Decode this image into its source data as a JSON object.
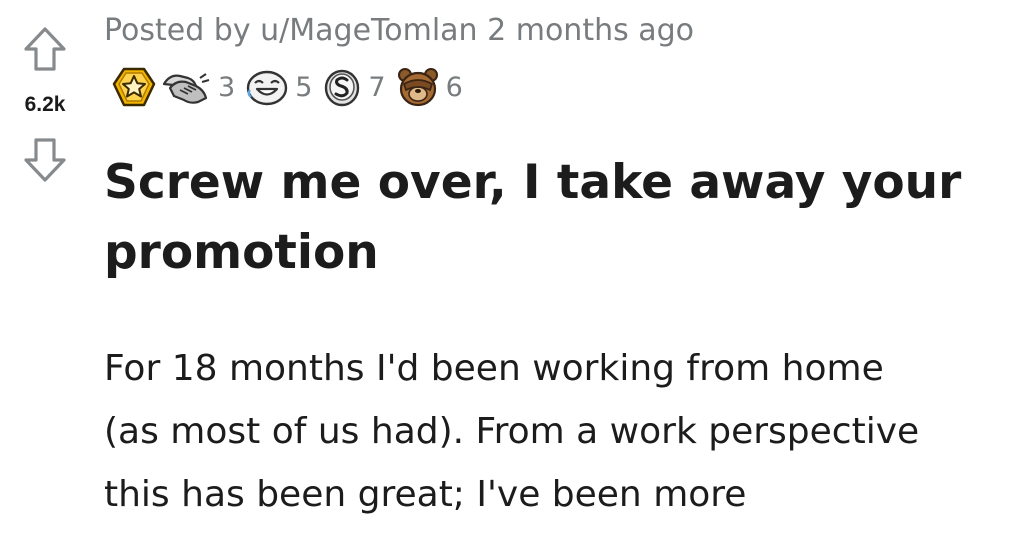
{
  "vote": {
    "score": "6.2k",
    "upvote_icon": "upvote-arrow-icon",
    "downvote_icon": "downvote-arrow-icon"
  },
  "post": {
    "meta": "Posted by u/MageTomlan 2 months ago",
    "title_line1": "Screw me over, I take away your",
    "title_line2": "promotion",
    "body_line1": "For 18 months I'd been working from home",
    "body_line2": "(as most of us had). From a work perspective",
    "body_line3": "this has been great; I've been more"
  },
  "awards": [
    {
      "icon": "gold-star-award-icon",
      "count": ""
    },
    {
      "icon": "handshake-award-icon",
      "count": "3"
    },
    {
      "icon": "laughing-face-award-icon",
      "count": "5"
    },
    {
      "icon": "silver-coin-award-icon",
      "count": "7"
    },
    {
      "icon": "bear-facepalm-award-icon",
      "count": "6"
    }
  ],
  "colors": {
    "text": "#1c1c1c",
    "meta": "#787c7e",
    "icon_stroke": "#878a8c",
    "gold": "#f5b400"
  }
}
